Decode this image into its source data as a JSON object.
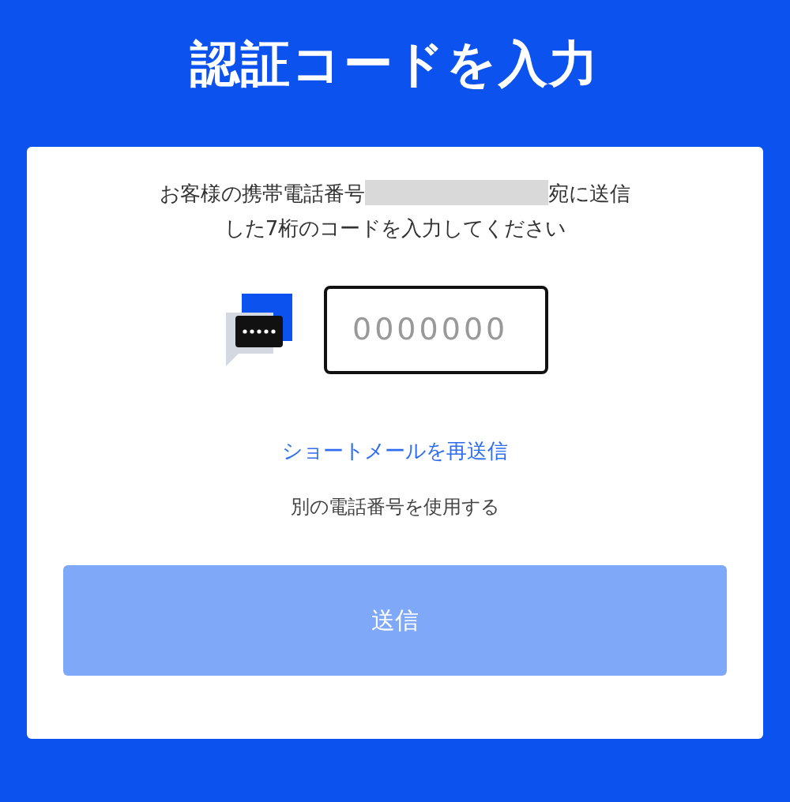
{
  "title": "認証コードを入力",
  "instruction": {
    "before": "お客様の携帯電話番号",
    "after": "宛に送信した7桁のコードを入力してください"
  },
  "code_field": {
    "placeholder": "0000000"
  },
  "resend_link": "ショートメールを再送信",
  "other_number_link": "別の電話番号を使用する",
  "submit_button": {
    "label": "送信",
    "disabled": true
  }
}
